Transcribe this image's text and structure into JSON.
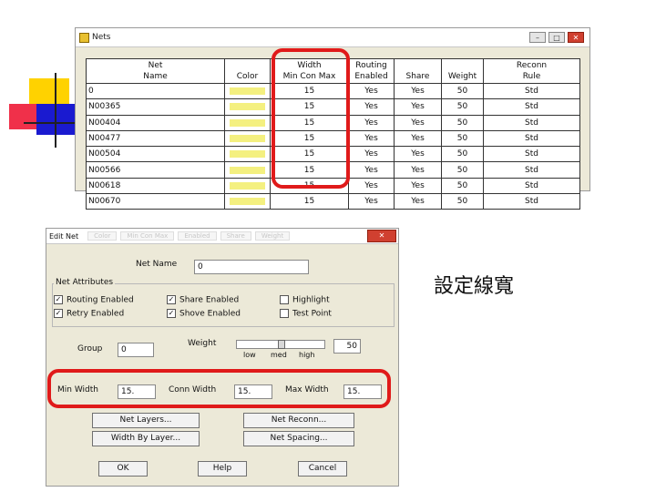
{
  "nets_window": {
    "title": "Nets",
    "buttons": {
      "minimize": "–",
      "maximize": "□",
      "close": "✕"
    },
    "header_row1": [
      "Net",
      "",
      "Width",
      "Routing",
      "",
      "",
      "Reconn"
    ],
    "header_row2": [
      "Name",
      "Color",
      "Min Con Max",
      "Enabled",
      "Share",
      "Weight",
      "Rule"
    ],
    "rows": [
      {
        "name": "0",
        "width": "15",
        "routing": "Yes",
        "share": "Yes",
        "weight": "50",
        "rule": "Std"
      },
      {
        "name": "N00365",
        "width": "15",
        "routing": "Yes",
        "share": "Yes",
        "weight": "50",
        "rule": "Std"
      },
      {
        "name": "N00404",
        "width": "15",
        "routing": "Yes",
        "share": "Yes",
        "weight": "50",
        "rule": "Std"
      },
      {
        "name": "N00477",
        "width": "15",
        "routing": "Yes",
        "share": "Yes",
        "weight": "50",
        "rule": "Std"
      },
      {
        "name": "N00504",
        "width": "15",
        "routing": "Yes",
        "share": "Yes",
        "weight": "50",
        "rule": "Std"
      },
      {
        "name": "N00566",
        "width": "15",
        "routing": "Yes",
        "share": "Yes",
        "weight": "50",
        "rule": "Std"
      },
      {
        "name": "N00618",
        "width": "15",
        "routing": "Yes",
        "share": "Yes",
        "weight": "50",
        "rule": "Std"
      },
      {
        "name": "N00670",
        "width": "15",
        "routing": "Yes",
        "share": "Yes",
        "weight": "50",
        "rule": "Std"
      }
    ],
    "color_swatch": "#f4f080"
  },
  "edit_net": {
    "title": "Edit Net",
    "ghost_tabs": [
      "Color",
      "Min Con Max",
      "Enabled",
      "Share",
      "Weight"
    ],
    "close": "✕",
    "net_name_label": "Net Name",
    "net_name_value": "0",
    "attributes_legend": "Net Attributes",
    "checkboxes": [
      {
        "label": "Routing Enabled",
        "checked": true
      },
      {
        "label": "Retry Enabled",
        "checked": true
      },
      {
        "label": "Share Enabled",
        "checked": true
      },
      {
        "label": "Shove Enabled",
        "checked": true
      },
      {
        "label": "Highlight",
        "checked": false
      },
      {
        "label": "Test Point",
        "checked": false
      }
    ],
    "check_mark": "✓",
    "group_label": "Group",
    "group_value": "0",
    "weight_label": "Weight",
    "weight_value": "50",
    "weight_level": 0.5,
    "slider_labels": [
      "low",
      "med",
      "high"
    ],
    "min_width_label": "Min Width",
    "min_width_value": "15.",
    "conn_width_label": "Conn Width",
    "conn_width_value": "15.",
    "max_width_label": "Max Width",
    "max_width_value": "15.",
    "buttons": {
      "net_layers": "Net Layers...",
      "net_reconn": "Net Reconn...",
      "width_by_layer": "Width By Layer...",
      "net_spacing": "Net Spacing...",
      "ok": "OK",
      "help": "Help",
      "cancel": "Cancel"
    }
  },
  "caption": "設定線寬",
  "accent_colors": {
    "highlight": "#e01a1a",
    "yellow": "#ffd200",
    "red": "#f0304a",
    "blue": "#1a1ad0"
  }
}
